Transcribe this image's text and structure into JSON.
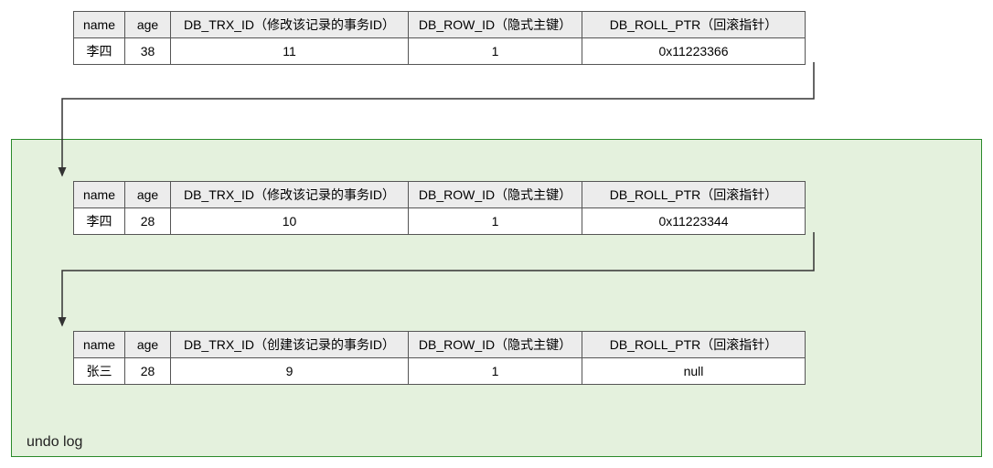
{
  "records": [
    {
      "headers": {
        "name": "name",
        "age": "age",
        "trx": "DB_TRX_ID（修改该记录的事务ID）",
        "rowid": "DB_ROW_ID（隐式主键）",
        "rollptr": "DB_ROLL_PTR（回滚指针）"
      },
      "row": {
        "name": "李四",
        "age": "38",
        "trx": "11",
        "rowid": "1",
        "rollptr": "0x11223366"
      }
    },
    {
      "headers": {
        "name": "name",
        "age": "age",
        "trx": "DB_TRX_ID（修改该记录的事务ID）",
        "rowid": "DB_ROW_ID（隐式主键）",
        "rollptr": "DB_ROLL_PTR（回滚指针）"
      },
      "row": {
        "name": "李四",
        "age": "28",
        "trx": "10",
        "rowid": "1",
        "rollptr": "0x11223344"
      }
    },
    {
      "headers": {
        "name": "name",
        "age": "age",
        "trx": "DB_TRX_ID（创建该记录的事务ID）",
        "rowid": "DB_ROW_ID（隐式主键）",
        "rollptr": "DB_ROLL_PTR（回滚指针）"
      },
      "row": {
        "name": "张三",
        "age": "28",
        "trx": "9",
        "rowid": "1",
        "rollptr": "null"
      }
    }
  ],
  "undo_label": "undo log",
  "colors": {
    "undo_border": "#2a8a2a",
    "undo_bg": "#e4f1dd",
    "arrow": "#333333"
  }
}
